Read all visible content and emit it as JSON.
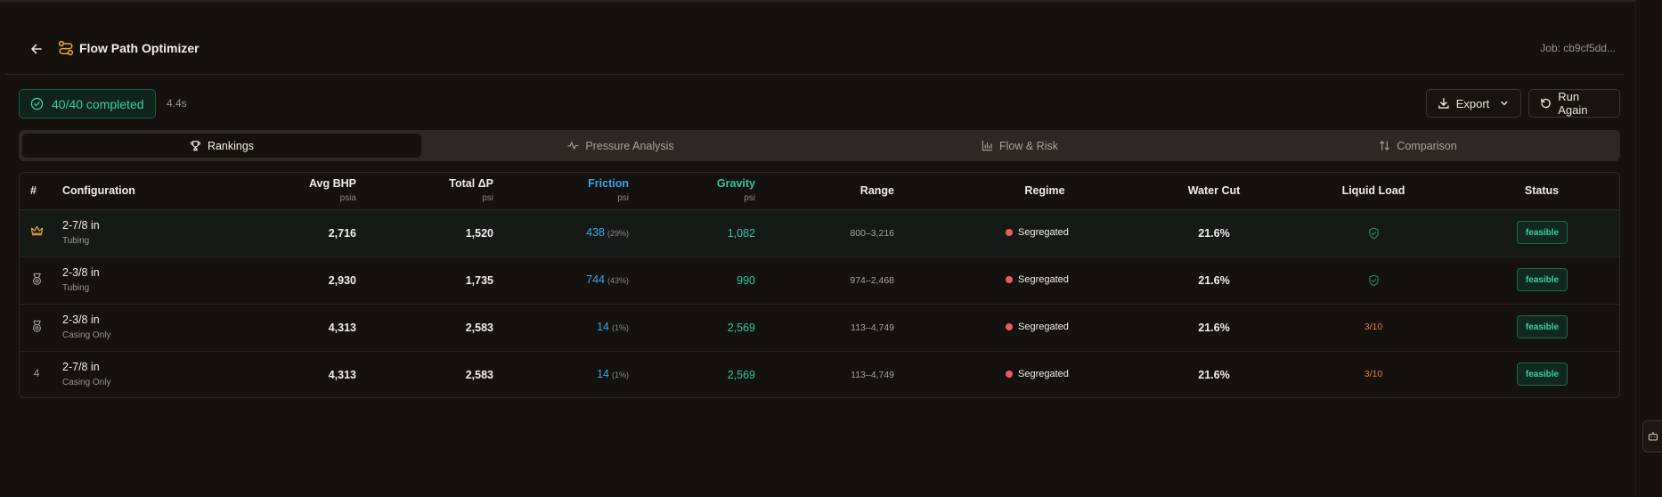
{
  "header": {
    "title": "Flow Path Optimizer",
    "job": "Job: cb9cf5dd..."
  },
  "toolbar": {
    "status": "40/40 completed",
    "elapsed": "4.4s",
    "export_label": "Export",
    "run_label": "Run Again"
  },
  "tabs": [
    {
      "label": "Rankings",
      "icon": "trophy-icon",
      "active": true
    },
    {
      "label": "Pressure Analysis",
      "icon": "activity-icon",
      "active": false
    },
    {
      "label": "Flow & Risk",
      "icon": "bar-chart-icon",
      "active": false
    },
    {
      "label": "Comparison",
      "icon": "sort-arrows-icon",
      "active": false
    }
  ],
  "table": {
    "columns": {
      "rank": "#",
      "configuration": "Configuration",
      "avg_bhp": "Avg BHP",
      "avg_bhp_unit": "psia",
      "total_dp": "Total ΔP",
      "total_dp_unit": "psi",
      "friction": "Friction",
      "friction_unit": "psi",
      "gravity": "Gravity",
      "gravity_unit": "psi",
      "range": "Range",
      "regime": "Regime",
      "water_cut": "Water Cut",
      "liquid_load": "Liquid Load",
      "status": "Status"
    },
    "rows": [
      {
        "rank_icon": "crown-icon",
        "rank": "",
        "size": "2-7/8 in",
        "type": "Tubing",
        "avg_bhp": "2,716",
        "total_dp": "1,520",
        "friction": "438",
        "friction_pct": "(29%)",
        "gravity": "1,082",
        "range": "800–3,216",
        "regime": "Segregated",
        "water_cut": "21.6%",
        "liquid_load": "",
        "liquid_load_icon": "shield-check-icon",
        "status": "feasible"
      },
      {
        "rank_icon": "medal-icon",
        "rank": "",
        "size": "2-3/8 in",
        "type": "Tubing",
        "avg_bhp": "2,930",
        "total_dp": "1,735",
        "friction": "744",
        "friction_pct": "(43%)",
        "gravity": "990",
        "range": "974–2,468",
        "regime": "Segregated",
        "water_cut": "21.6%",
        "liquid_load": "",
        "liquid_load_icon": "shield-check-icon",
        "status": "feasible"
      },
      {
        "rank_icon": "medal-icon",
        "rank": "",
        "size": "2-3/8 in",
        "type": "Casing Only",
        "avg_bhp": "4,313",
        "total_dp": "2,583",
        "friction": "14",
        "friction_pct": "(1%)",
        "gravity": "2,569",
        "range": "113–4,749",
        "regime": "Segregated",
        "water_cut": "21.6%",
        "liquid_load": "3/10",
        "liquid_load_icon": "",
        "status": "feasible"
      },
      {
        "rank_icon": "",
        "rank": "4",
        "size": "2-7/8 in",
        "type": "Casing Only",
        "avg_bhp": "4,313",
        "total_dp": "2,583",
        "friction": "14",
        "friction_pct": "(1%)",
        "gravity": "2,569",
        "range": "113–4,749",
        "regime": "Segregated",
        "water_cut": "21.6%",
        "liquid_load": "3/10",
        "liquid_load_icon": "",
        "status": "feasible"
      }
    ]
  },
  "colors": {
    "accent_green": "#36d39a",
    "friction_blue": "#3aa7ee",
    "gravity_teal": "#2fc7a4",
    "regime_red": "#ee5a63",
    "warn_orange": "#f07d34",
    "crown_gold": "#f0a730"
  }
}
